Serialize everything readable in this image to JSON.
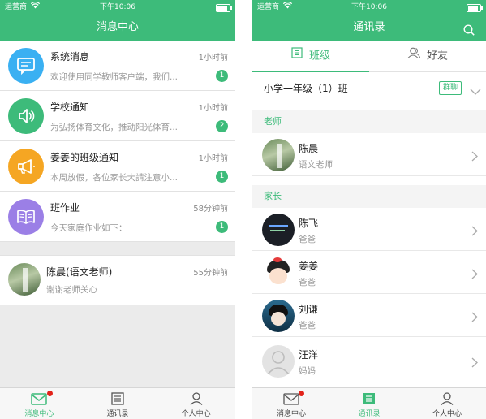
{
  "left": {
    "status": {
      "carrier": "运营商",
      "time": "下午10:06"
    },
    "nav_title": "消息中心",
    "messages": [
      {
        "title": "系统消息",
        "time": "1小时前",
        "preview": "欢迎使用同学教师客户端，我们...",
        "badge": "1",
        "icon": "chat-bubble-icon",
        "color": "#3ab0f2"
      },
      {
        "title": "学校通知",
        "time": "1小时前",
        "preview": "为弘扬体育文化，推动阳光体育...",
        "badge": "2",
        "icon": "speaker-icon",
        "color": "#3dbb7a"
      },
      {
        "title": "姜姜的班级通知",
        "time": "1小时前",
        "preview": "本周放假，各位家长大請注意小...",
        "badge": "1",
        "icon": "megaphone-icon",
        "color": "#f5a623"
      },
      {
        "title": "班作业",
        "time": "58分钟前",
        "preview": "今天家庭作业如下：",
        "badge": "1",
        "icon": "book-icon",
        "color": "#9b7fe6"
      }
    ],
    "teacher_chat": {
      "name": "陈晨(语文老师)",
      "time": "55分钟前",
      "preview": "谢谢老师关心"
    },
    "tabbar": [
      {
        "label": "消息中心",
        "icon": "envelope-icon",
        "active": true
      },
      {
        "label": "通讯录",
        "icon": "contacts-list-icon",
        "active": false
      },
      {
        "label": "个人中心",
        "icon": "person-icon",
        "active": false
      }
    ]
  },
  "right": {
    "status": {
      "carrier": "运营商",
      "time": "下午10:06"
    },
    "nav_title": "通讯录",
    "segments": {
      "class_tab": "班级",
      "friends_tab": "好友"
    },
    "class_row": {
      "name": "小学一年级（1）班",
      "chip": "群聊"
    },
    "teacher_header": "老师",
    "teachers": [
      {
        "name": "陈晨",
        "role": "语文老师"
      }
    ],
    "parent_header": "家长",
    "parents": [
      {
        "name": "陈飞",
        "role": "爸爸"
      },
      {
        "name": "姜姜",
        "role": "爸爸"
      },
      {
        "name": "刘谦",
        "role": "爸爸"
      },
      {
        "name": "汪洋",
        "role": "妈妈"
      }
    ],
    "tabbar": [
      {
        "label": "消息中心",
        "icon": "envelope-icon",
        "active": false
      },
      {
        "label": "通讯录",
        "icon": "contacts-list-icon",
        "active": true
      },
      {
        "label": "个人中心",
        "icon": "person-icon",
        "active": false
      }
    ]
  },
  "colors": {
    "brand_green": "#3dbb7a",
    "badge_red": "#e2231a"
  }
}
